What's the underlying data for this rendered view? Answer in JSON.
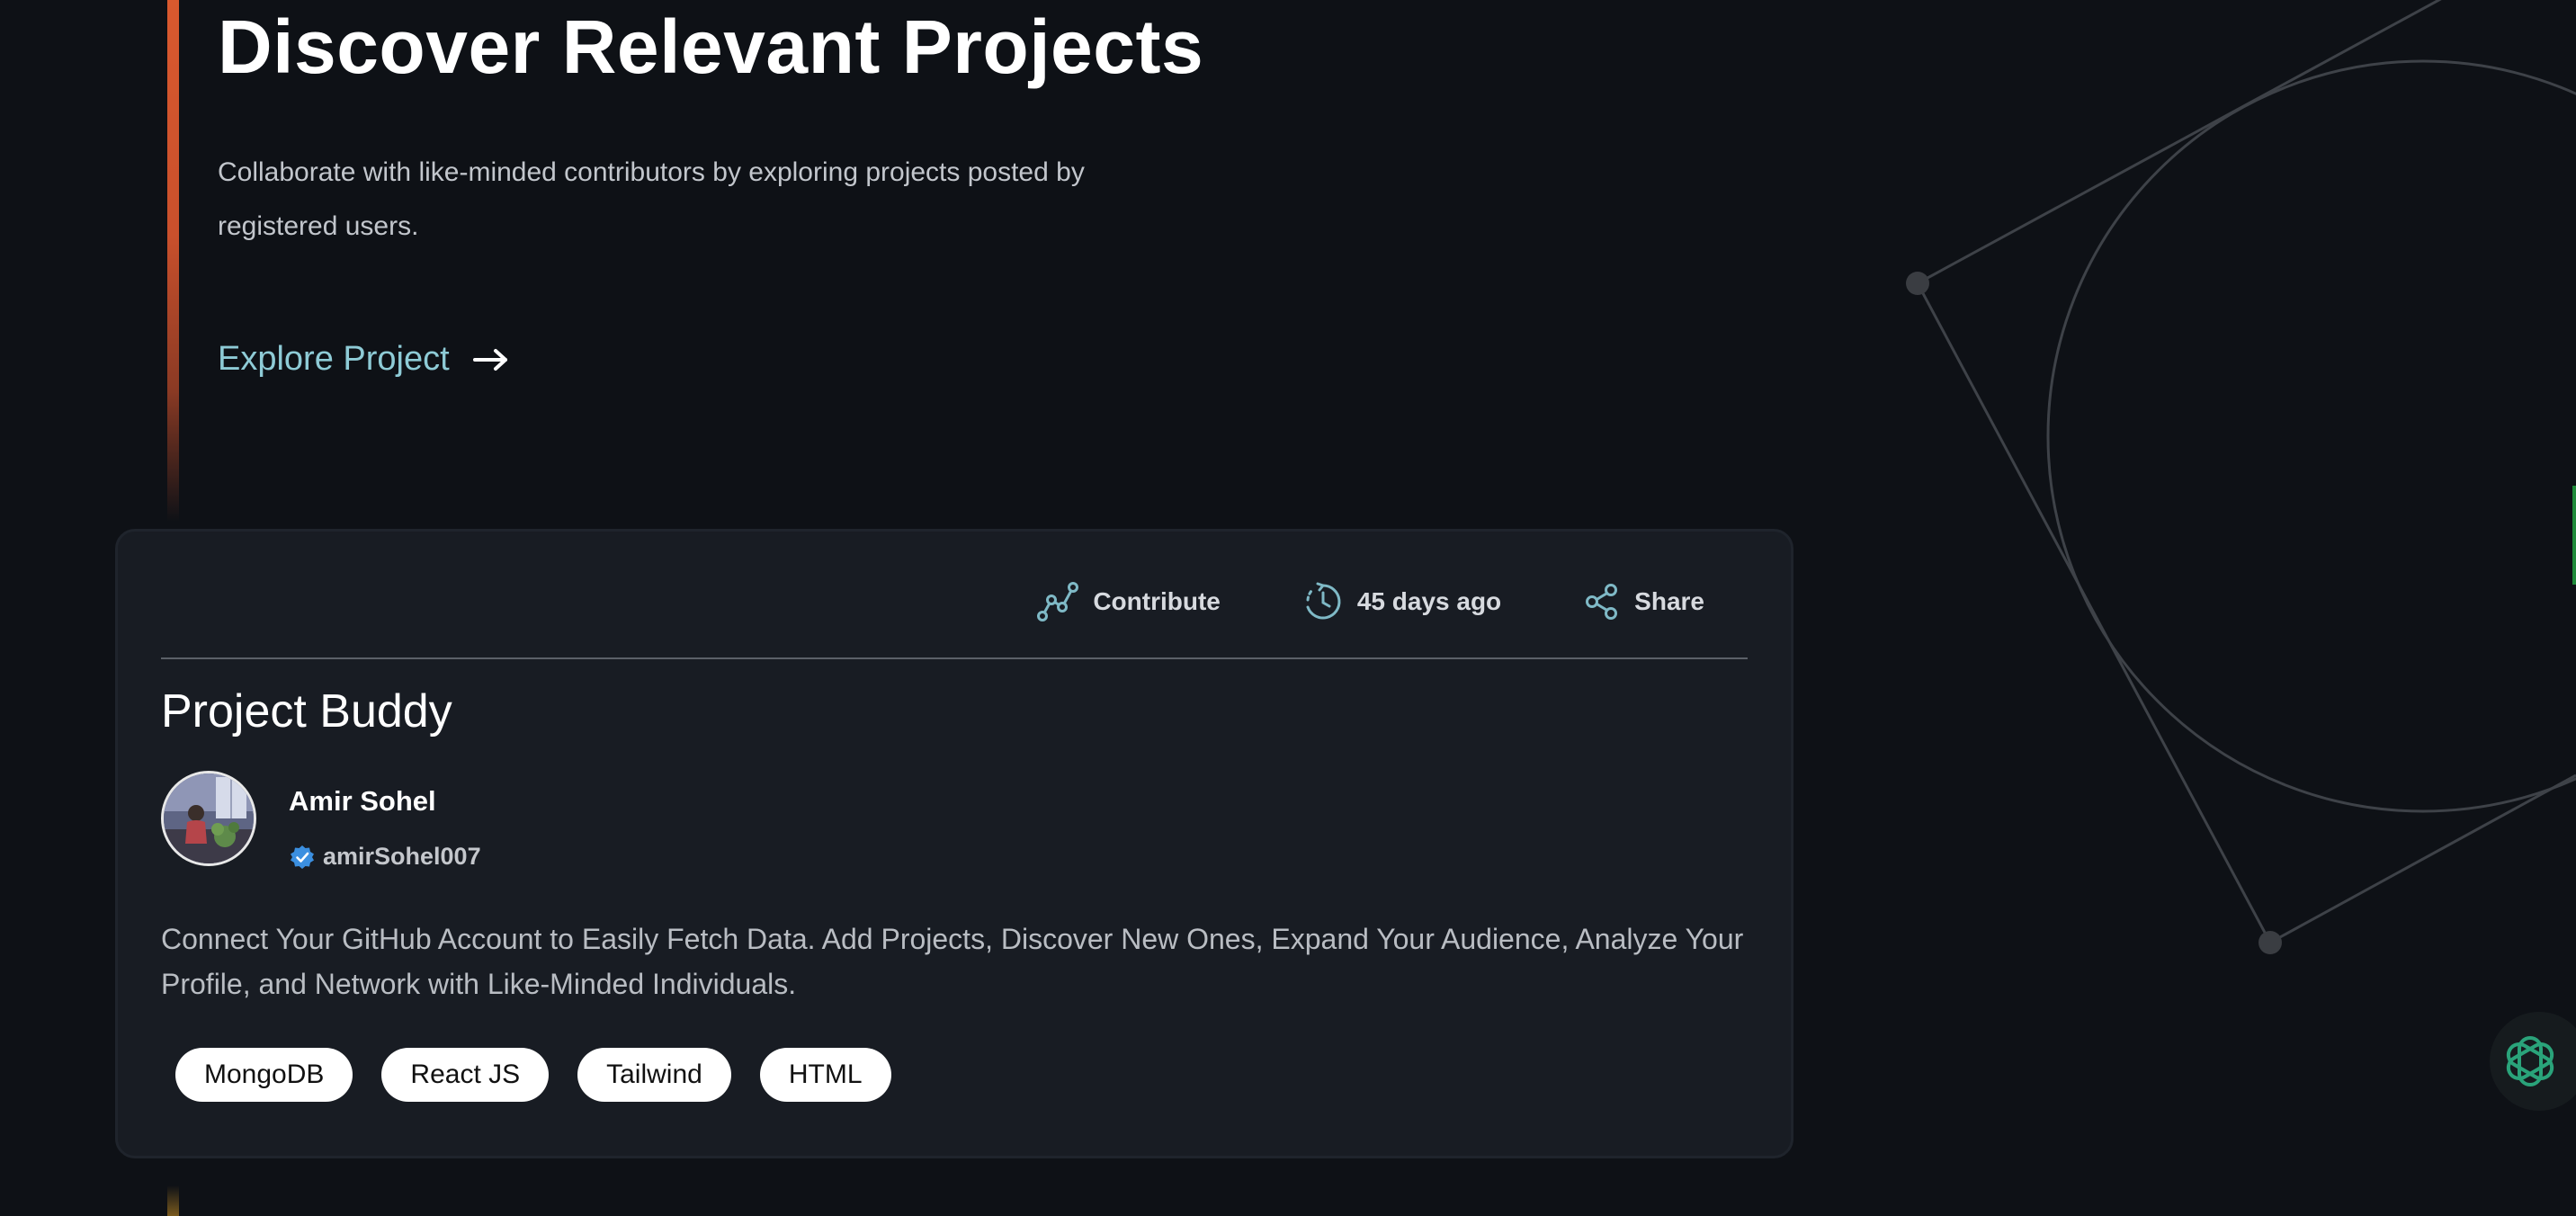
{
  "hero": {
    "title": "Discover Relevant Projects",
    "subtitle": "Collaborate with like-minded contributors by exploring projects posted by registered users.",
    "explore_label": "Explore Project"
  },
  "project": {
    "actions": {
      "contribute_label": "Contribute",
      "posted_label": "45 days ago",
      "share_label": "Share"
    },
    "title": "Project Buddy",
    "author": {
      "name": "Amir Sohel",
      "handle": "amirSohel007"
    },
    "description": "Connect Your GitHub Account to Easily Fetch Data. Add Projects, Discover New Ones, Expand Your Audience, Analyze Your Profile, and Network with Like-Minded Individuals.",
    "tags": [
      "MongoDB",
      "React JS",
      "Tailwind",
      "HTML"
    ]
  },
  "icons": {
    "explore": "arrow-right-icon",
    "contribute": "graph-line-icon",
    "posted": "clock-history-icon",
    "share": "share-icon",
    "verified": "verified-badge-icon",
    "assistant": "openai-logo-icon"
  },
  "colors": {
    "background": "#0e1116",
    "card": "#181c23",
    "accent_orange": "#d9592e",
    "link": "#8ecbd6",
    "verified": "#3b8fe0",
    "assistant": "#2aa37a"
  }
}
